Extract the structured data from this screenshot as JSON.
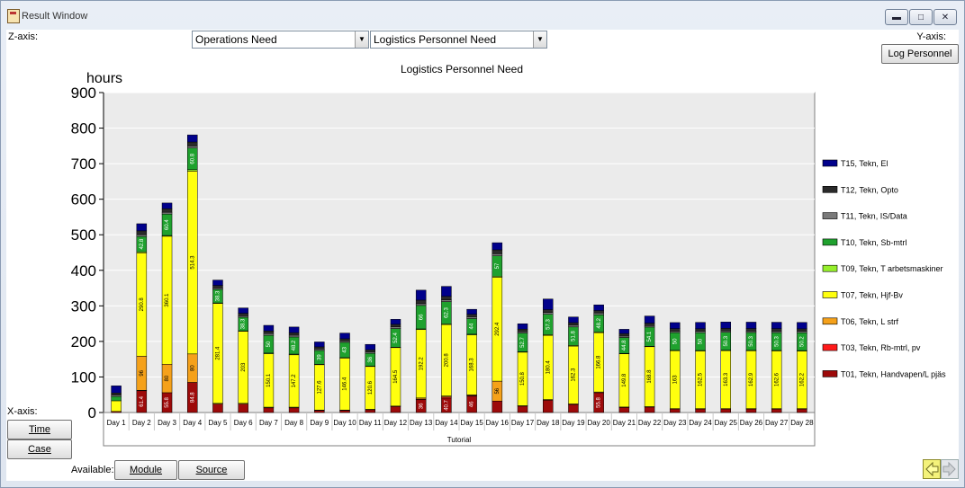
{
  "window": {
    "title": "Result Window"
  },
  "controls": {
    "z_axis_label": "Z-axis:",
    "y_axis_label": "Y-axis:",
    "x_axis_label": "X-axis:",
    "combo1": "Operations Need",
    "combo2": "Logistics Personnel Need",
    "y_button": "Log Personnel",
    "time_button": "Time",
    "case_button": "Case",
    "available_label": "Available:",
    "module_button": "Module",
    "source_button": "Source"
  },
  "colors": {
    "T15": "#00008b",
    "T12": "#2a2a2a",
    "T11": "#7a7a7a",
    "T10": "#1fa12e",
    "T09": "#96ef2c",
    "T07": "#ffff0e",
    "T06": "#f5a11a",
    "T03": "#ff1a1a",
    "T01": "#9d0a0a",
    "plot_bg": "#ebebeb"
  },
  "chart_data": {
    "type": "bar",
    "stacked": true,
    "title": "Logistics Personnel Need",
    "ylabel": "hours",
    "xlabel": "Tutorial",
    "ylim": [
      0,
      900
    ],
    "yticks": [
      0,
      100,
      200,
      300,
      400,
      500,
      600,
      700,
      800,
      900
    ],
    "grid": true,
    "legend_position": "right",
    "categories": [
      "Day 1",
      "Day 2",
      "Day 3",
      "Day 4",
      "Day 5",
      "Day 6",
      "Day 7",
      "Day 8",
      "Day 9",
      "Day 10",
      "Day 11",
      "Day 12",
      "Day 13",
      "Day 14",
      "Day 15",
      "Day 16",
      "Day 17",
      "Day 18",
      "Day 19",
      "Day 20",
      "Day 21",
      "Day 22",
      "Day 23",
      "Day 24",
      "Day 25",
      "Day 26",
      "Day 27",
      "Day 28"
    ],
    "series": [
      {
        "name": "T01, Tekn, Handvapen/L pjäs",
        "key": "T01",
        "values": [
          3,
          61.4,
          55.8,
          84.8,
          23.8,
          23.8,
          13.1,
          13.1,
          6,
          6,
          8,
          17.2,
          36,
          40.7,
          46,
          32.2,
          18.1,
          34.6,
          22.6,
          55.8,
          14.5,
          15.5,
          10,
          10,
          10,
          10,
          10,
          10
        ]
      },
      {
        "name": "T03, Tekn, Rb-mtrl, pv",
        "key": "T03",
        "values": [
          0,
          1,
          0,
          0,
          0,
          0,
          0,
          0,
          0,
          0,
          0,
          0,
          2,
          3,
          2,
          0,
          0,
          0,
          0,
          0,
          0,
          0,
          0,
          0,
          0,
          0,
          0,
          0
        ]
      },
      {
        "name": "T06, Tekn, L strf",
        "key": "T06",
        "values": [
          0,
          96,
          80,
          80,
          2,
          2,
          2,
          2,
          1,
          1,
          1,
          1,
          3,
          3,
          2,
          56,
          1,
          2,
          2,
          2,
          1,
          1,
          1,
          1,
          1,
          1,
          1,
          1
        ]
      },
      {
        "name": "T07, Tekn, Hjf-Bv",
        "key": "T07",
        "values": [
          30,
          290.8,
          360.1,
          514.3,
          281.4,
          203,
          150.1,
          147.2,
          127.6,
          146.4,
          120.6,
          164.5,
          192.2,
          200.8,
          168.3,
          292.4,
          150.8,
          180.4,
          162.3,
          166.8,
          149.8,
          168.8,
          163,
          162.5,
          163.3,
          162.9,
          162.6,
          162.2
        ]
      },
      {
        "name": "T09, Tekn, T arbetsmaskiner",
        "key": "T09",
        "values": [
          0,
          3,
          2,
          4,
          1,
          1,
          2,
          2,
          1,
          1,
          1,
          1,
          2,
          2,
          2,
          3,
          1,
          2,
          2,
          2,
          1,
          1,
          1,
          1,
          1,
          1,
          1,
          1
        ]
      },
      {
        "name": "T10, Tekn, Sb-mtrl",
        "key": "T10",
        "values": [
          12,
          42.8,
          60.4,
          60.8,
          38.3,
          38.3,
          50,
          48.2,
          39,
          43,
          36,
          52.4,
          66,
          62.3,
          44,
          57,
          52.7,
          57.3,
          51.8,
          48.2,
          44.8,
          54.1,
          50,
          50,
          50.3,
          50.3,
          50.3,
          50.2
        ]
      },
      {
        "name": "T11, Tekn, IS/Data",
        "key": "T11",
        "values": [
          4,
          5,
          5,
          6,
          4,
          4,
          5,
          5,
          4,
          4,
          4,
          5,
          5,
          5,
          5,
          6,
          4,
          5,
          5,
          5,
          4,
          4,
          4,
          4,
          4,
          4,
          4,
          4
        ]
      },
      {
        "name": "T12, Tekn, Opto",
        "key": "T12",
        "values": [
          6,
          11,
          10,
          11,
          7,
          7,
          7,
          7,
          6,
          6,
          6,
          7,
          10,
          10,
          7,
          11,
          7,
          8,
          7,
          7,
          7,
          7,
          7,
          7,
          7,
          7,
          7,
          7
        ]
      },
      {
        "name": "T15, Tekn, El",
        "key": "T15",
        "values": [
          20,
          20,
          16,
          20,
          15,
          15,
          16,
          16,
          14,
          16,
          15,
          14,
          28,
          28,
          14,
          20,
          15,
          30,
          16,
          16,
          12,
          20,
          17,
          18,
          18,
          18,
          18,
          18
        ]
      }
    ]
  }
}
